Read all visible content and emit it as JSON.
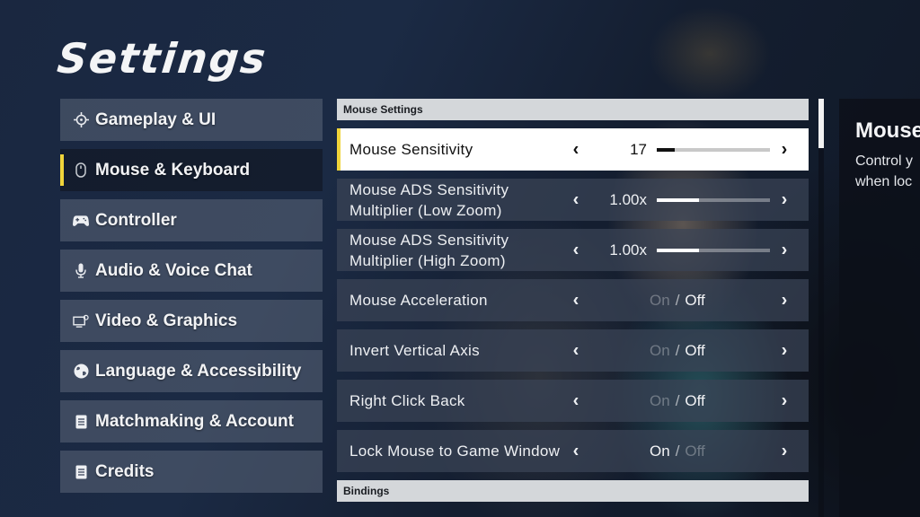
{
  "page": {
    "title": "Settings",
    "accent_color": "#f0d43a"
  },
  "sidebar": {
    "items": [
      {
        "label": "Gameplay & UI",
        "icon": "crosshair-icon",
        "active": false
      },
      {
        "label": "Mouse & Keyboard",
        "icon": "mouse-icon",
        "active": true
      },
      {
        "label": "Controller",
        "icon": "gamepad-icon",
        "active": false
      },
      {
        "label": "Audio & Voice Chat",
        "icon": "microphone-icon",
        "active": false
      },
      {
        "label": "Video & Graphics",
        "icon": "monitor-icon",
        "active": false
      },
      {
        "label": "Language & Accessibility",
        "icon": "globe-icon",
        "active": false
      },
      {
        "label": "Matchmaking & Account",
        "icon": "document-icon",
        "active": false
      },
      {
        "label": "Credits",
        "icon": "document-icon",
        "active": false
      }
    ]
  },
  "main": {
    "sections": [
      {
        "title": "Mouse Settings"
      },
      {
        "title": "Bindings"
      }
    ],
    "settings": [
      {
        "label": "Mouse Sensitivity",
        "type": "slider",
        "value": "17",
        "fill_percent": 16,
        "selected": true
      },
      {
        "label": "Mouse ADS Sensitivity Multiplier (Low Zoom)",
        "type": "slider",
        "value": "1.00x",
        "fill_percent": 37,
        "selected": false
      },
      {
        "label": "Mouse ADS Sensitivity Multiplier (High Zoom)",
        "type": "slider",
        "value": "1.00x",
        "fill_percent": 37,
        "selected": false
      },
      {
        "label": "Mouse Acceleration",
        "type": "toggle",
        "on_label": "On",
        "off_label": "Off",
        "separator": "/",
        "value": "Off",
        "selected": false
      },
      {
        "label": "Invert Vertical Axis",
        "type": "toggle",
        "on_label": "On",
        "off_label": "Off",
        "separator": "/",
        "value": "Off",
        "selected": false
      },
      {
        "label": "Right Click Back",
        "type": "toggle",
        "on_label": "On",
        "off_label": "Off",
        "separator": "/",
        "value": "Off",
        "selected": false
      },
      {
        "label": "Lock Mouse to Game Window",
        "type": "toggle",
        "on_label": "On",
        "off_label": "Off",
        "separator": "/",
        "value": "On",
        "selected": false
      }
    ],
    "arrow_left": "‹",
    "arrow_right": "›"
  },
  "description": {
    "title": "Mouse",
    "text_line1": "Control y",
    "text_line2": "when loc"
  },
  "scrollbar": {
    "position_percent": 0
  }
}
